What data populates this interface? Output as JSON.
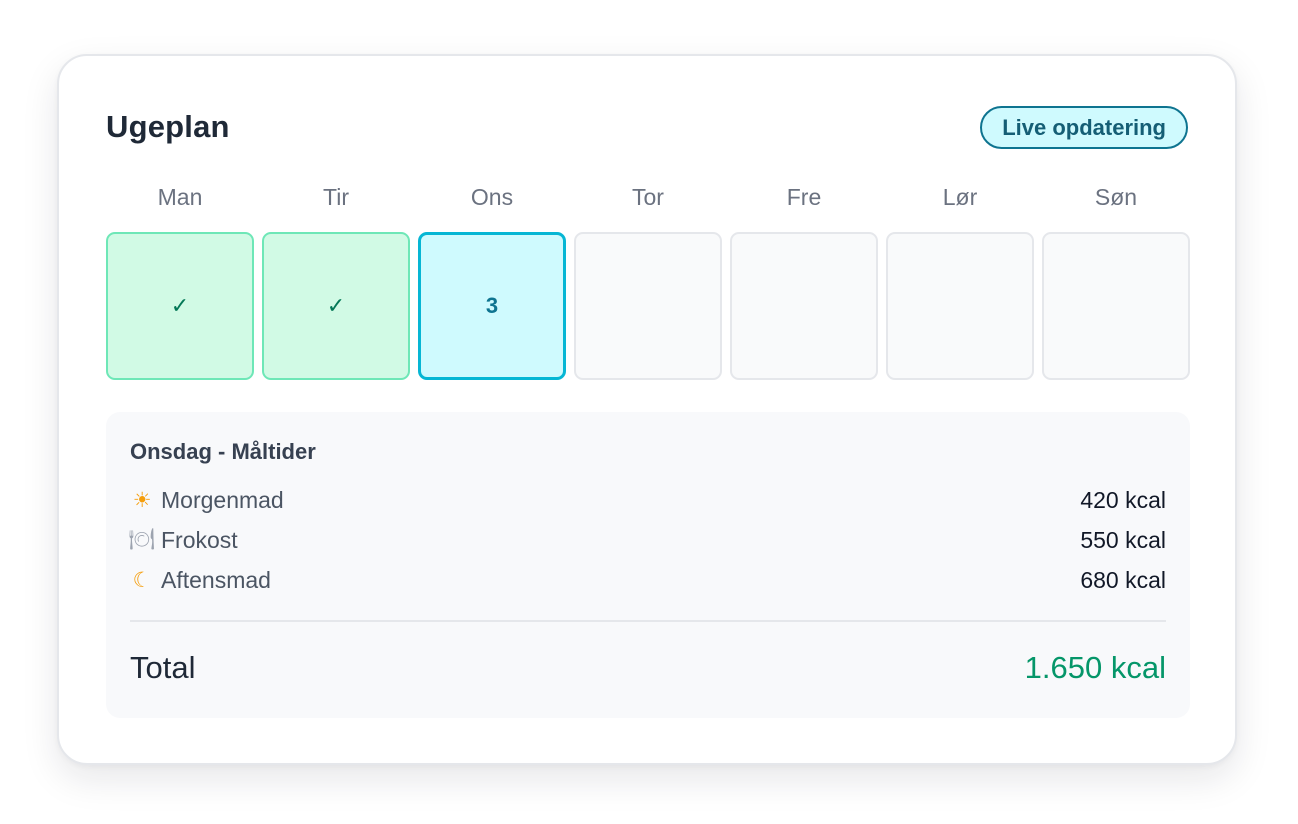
{
  "card": {
    "title": "Ugeplan",
    "badge": "Live opdatering"
  },
  "week": {
    "days": [
      {
        "label": "Man",
        "state": "done",
        "content": "✓"
      },
      {
        "label": "Tir",
        "state": "done",
        "content": "✓"
      },
      {
        "label": "Ons",
        "state": "active",
        "content": "3"
      },
      {
        "label": "Tor",
        "state": "empty",
        "content": ""
      },
      {
        "label": "Fre",
        "state": "empty",
        "content": ""
      },
      {
        "label": "Lør",
        "state": "empty",
        "content": ""
      },
      {
        "label": "Søn",
        "state": "empty",
        "content": ""
      }
    ]
  },
  "meals": {
    "title": "Onsdag - Måltider",
    "items": [
      {
        "icon": "☀",
        "icon_name": "sun-icon",
        "name": "Morgenmad",
        "kcal": "420 kcal"
      },
      {
        "icon": "🍽",
        "icon_name": "plate-icon",
        "name": "Frokost",
        "kcal": "550 kcal"
      },
      {
        "icon": "☾",
        "icon_name": "moon-icon",
        "name": "Aftensmad",
        "kcal": "680 kcal"
      }
    ],
    "total_label": "Total",
    "total_value": "1.650 kcal"
  },
  "colors": {
    "done_bg": "#d1fae5",
    "done_border": "#6ee7b7",
    "active_bg": "#cffafe",
    "active_border": "#06b6d4",
    "total_value": "#059669"
  }
}
